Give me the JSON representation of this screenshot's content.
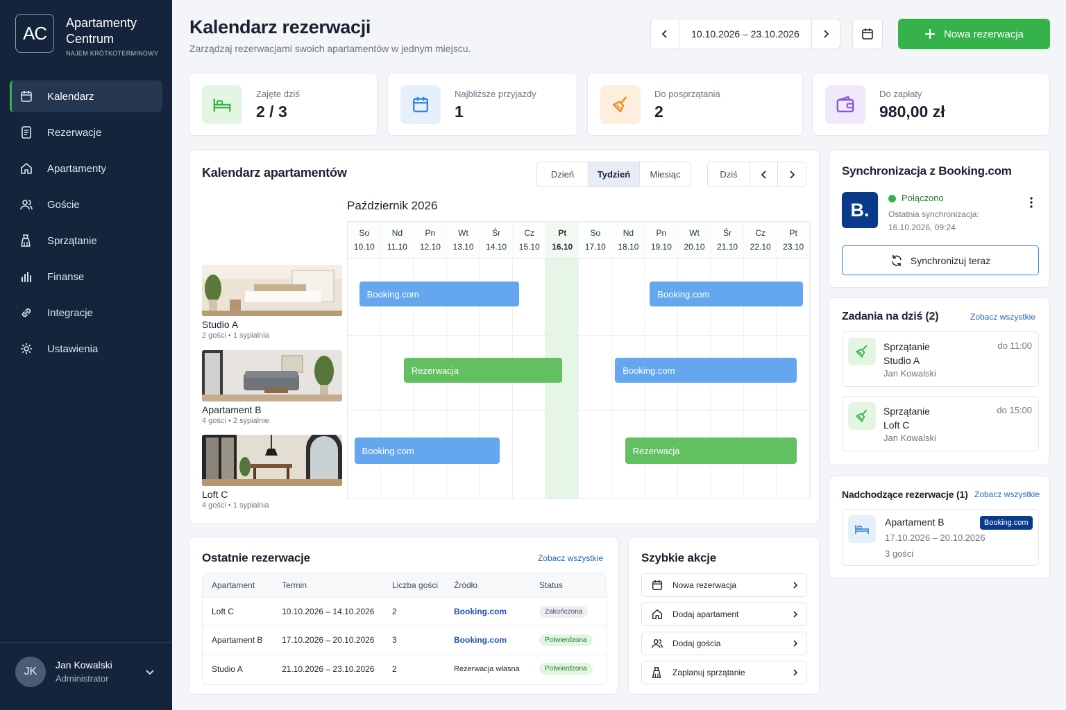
{
  "brand": {
    "logo": "AC",
    "name": "Apartamenty Centrum",
    "tagline": "NAJEM KRÓTKOTERMINOWY"
  },
  "nav": [
    {
      "label": "Kalendarz",
      "icon": "calendar-icon",
      "active": true
    },
    {
      "label": "Rezerwacje",
      "icon": "document-icon"
    },
    {
      "label": "Apartamenty",
      "icon": "home-icon"
    },
    {
      "label": "Goście",
      "icon": "users-icon"
    },
    {
      "label": "Sprzątanie",
      "icon": "cleaning-icon"
    },
    {
      "label": "Finanse",
      "icon": "chart-bars-icon"
    },
    {
      "label": "Integracje",
      "icon": "link-icon"
    },
    {
      "label": "Ustawienia",
      "icon": "gear-icon"
    }
  ],
  "user": {
    "initials": "JK",
    "name": "Jan Kowalski",
    "role": "Administrator"
  },
  "header": {
    "title": "Kalendarz rezerwacji",
    "subtitle": "Zarządzaj rezerwacjami swoich apartamentów w jednym miejscu.",
    "date_range": "10.10.2026 – 23.10.2026",
    "new_button": "Nowa rezerwacja"
  },
  "stats": [
    {
      "label": "Zajęte dziś",
      "value": "2 / 3",
      "icon": "bed-icon",
      "bg": "#e3f6e3",
      "fg": "#36b24b"
    },
    {
      "label": "Najbliższe przyjazdy",
      "value": "1",
      "icon": "calendar-icon",
      "bg": "#e6f0fb",
      "fg": "#2f7fd8"
    },
    {
      "label": "Do posprzątania",
      "value": "2",
      "icon": "broom-icon",
      "bg": "#fdeedd",
      "fg": "#f08c1e"
    },
    {
      "label": "Do zapłaty",
      "value": "980,00 zł",
      "icon": "wallet-icon",
      "bg": "#efe9fb",
      "fg": "#8a55d8"
    }
  ],
  "calendar": {
    "title": "Kalendarz apartamentów",
    "views": [
      "Dzień",
      "Tydzień",
      "Miesiąc"
    ],
    "active_view": "Tydzień",
    "today_label": "Dziś",
    "month": "Październik 2026",
    "days": [
      {
        "d": "So",
        "n": "10.10"
      },
      {
        "d": "Nd",
        "n": "11.10"
      },
      {
        "d": "Pn",
        "n": "12.10"
      },
      {
        "d": "Wt",
        "n": "13.10"
      },
      {
        "d": "Śr",
        "n": "14.10"
      },
      {
        "d": "Cz",
        "n": "15.10"
      },
      {
        "d": "Pt",
        "n": "16.10",
        "today": true
      },
      {
        "d": "So",
        "n": "17.10"
      },
      {
        "d": "Nd",
        "n": "18.10"
      },
      {
        "d": "Pn",
        "n": "19.10"
      },
      {
        "d": "Wt",
        "n": "20.10"
      },
      {
        "d": "Śr",
        "n": "21.10"
      },
      {
        "d": "Cz",
        "n": "22.10"
      },
      {
        "d": "Pt",
        "n": "23.10"
      }
    ],
    "apartments": [
      {
        "name": "Studio A",
        "desc": "2 gości • 1 sypialnia"
      },
      {
        "name": "Apartament B",
        "desc": "4 gości • 2 sypialnie"
      },
      {
        "name": "Loft C",
        "desc": "4 gości • 1 sypialnia"
      }
    ],
    "bookings": [
      {
        "row": 0,
        "start": 0.35,
        "end": 5.2,
        "label": "Booking.com",
        "kind": "blue"
      },
      {
        "row": 0,
        "start": 9.15,
        "end": 13.8,
        "label": "Booking.com",
        "kind": "blue"
      },
      {
        "row": 1,
        "start": 1.7,
        "end": 6.5,
        "label": "Rezerwacja",
        "kind": "green"
      },
      {
        "row": 1,
        "start": 8.1,
        "end": 13.6,
        "label": "Booking.com",
        "kind": "blue"
      },
      {
        "row": 2,
        "start": 0.2,
        "end": 4.6,
        "label": "Booking.com",
        "kind": "blue"
      },
      {
        "row": 2,
        "start": 8.4,
        "end": 13.6,
        "label": "Rezerwacja",
        "kind": "green"
      }
    ]
  },
  "recent": {
    "title": "Ostatnie rezerwacje",
    "link": "Zobacz wszystkie",
    "columns": [
      "Apartament",
      "Termin",
      "Liczba gości",
      "Źródło",
      "Status"
    ],
    "rows": [
      {
        "apt": "Loft C",
        "term": "10.10.2026 – 14.10.2026",
        "guests": "2",
        "src": "Booking.com",
        "src_bold": true,
        "status": "Zakończona",
        "status_kind": "grey"
      },
      {
        "apt": "Apartament B",
        "term": "17.10.2026 – 20.10.2026",
        "guests": "3",
        "src": "Booking.com",
        "src_bold": true,
        "status": "Potwierdzona",
        "status_kind": "green"
      },
      {
        "apt": "Studio A",
        "term": "21.10.2026 – 23.10.2026",
        "guests": "2",
        "src": "Rezerwacja własna",
        "src_bold": false,
        "status": "Potwierdzona",
        "status_kind": "green"
      }
    ]
  },
  "quick": {
    "title": "Szybkie akcje",
    "items": [
      {
        "label": "Nowa rezerwacja",
        "icon": "calendar-icon"
      },
      {
        "label": "Dodaj apartament",
        "icon": "home-icon"
      },
      {
        "label": "Dodaj gościa",
        "icon": "users-icon"
      },
      {
        "label": "Zaplanuj sprzątanie",
        "icon": "cleaning-icon"
      }
    ]
  },
  "sync": {
    "title": "Synchronizacja z Booking.com",
    "logo": "B.",
    "status": "Połączono",
    "last_label": "Ostatnia synchronizacja:",
    "last_time": "16.10.2026, 09:24",
    "button": "Synchronizuj teraz",
    "status_color": "#36b24b"
  },
  "tasks": {
    "title": "Zadania na dziś (2)",
    "link": "Zobacz wszystkie",
    "items": [
      {
        "type": "Sprzątanie",
        "apt": "Studio A",
        "person": "Jan Kowalski",
        "time": "do 11:00"
      },
      {
        "type": "Sprzątanie",
        "apt": "Loft C",
        "person": "Jan Kowalski",
        "time": "do 15:00"
      }
    ]
  },
  "upcoming": {
    "title": "Nadchodzące rezerwacje (1)",
    "link": "Zobacz wszystkie",
    "item": {
      "apt": "Apartament B",
      "dates": "17.10.2026 – 20.10.2026",
      "guests": "3 gości",
      "badge": "Booking.com"
    }
  }
}
